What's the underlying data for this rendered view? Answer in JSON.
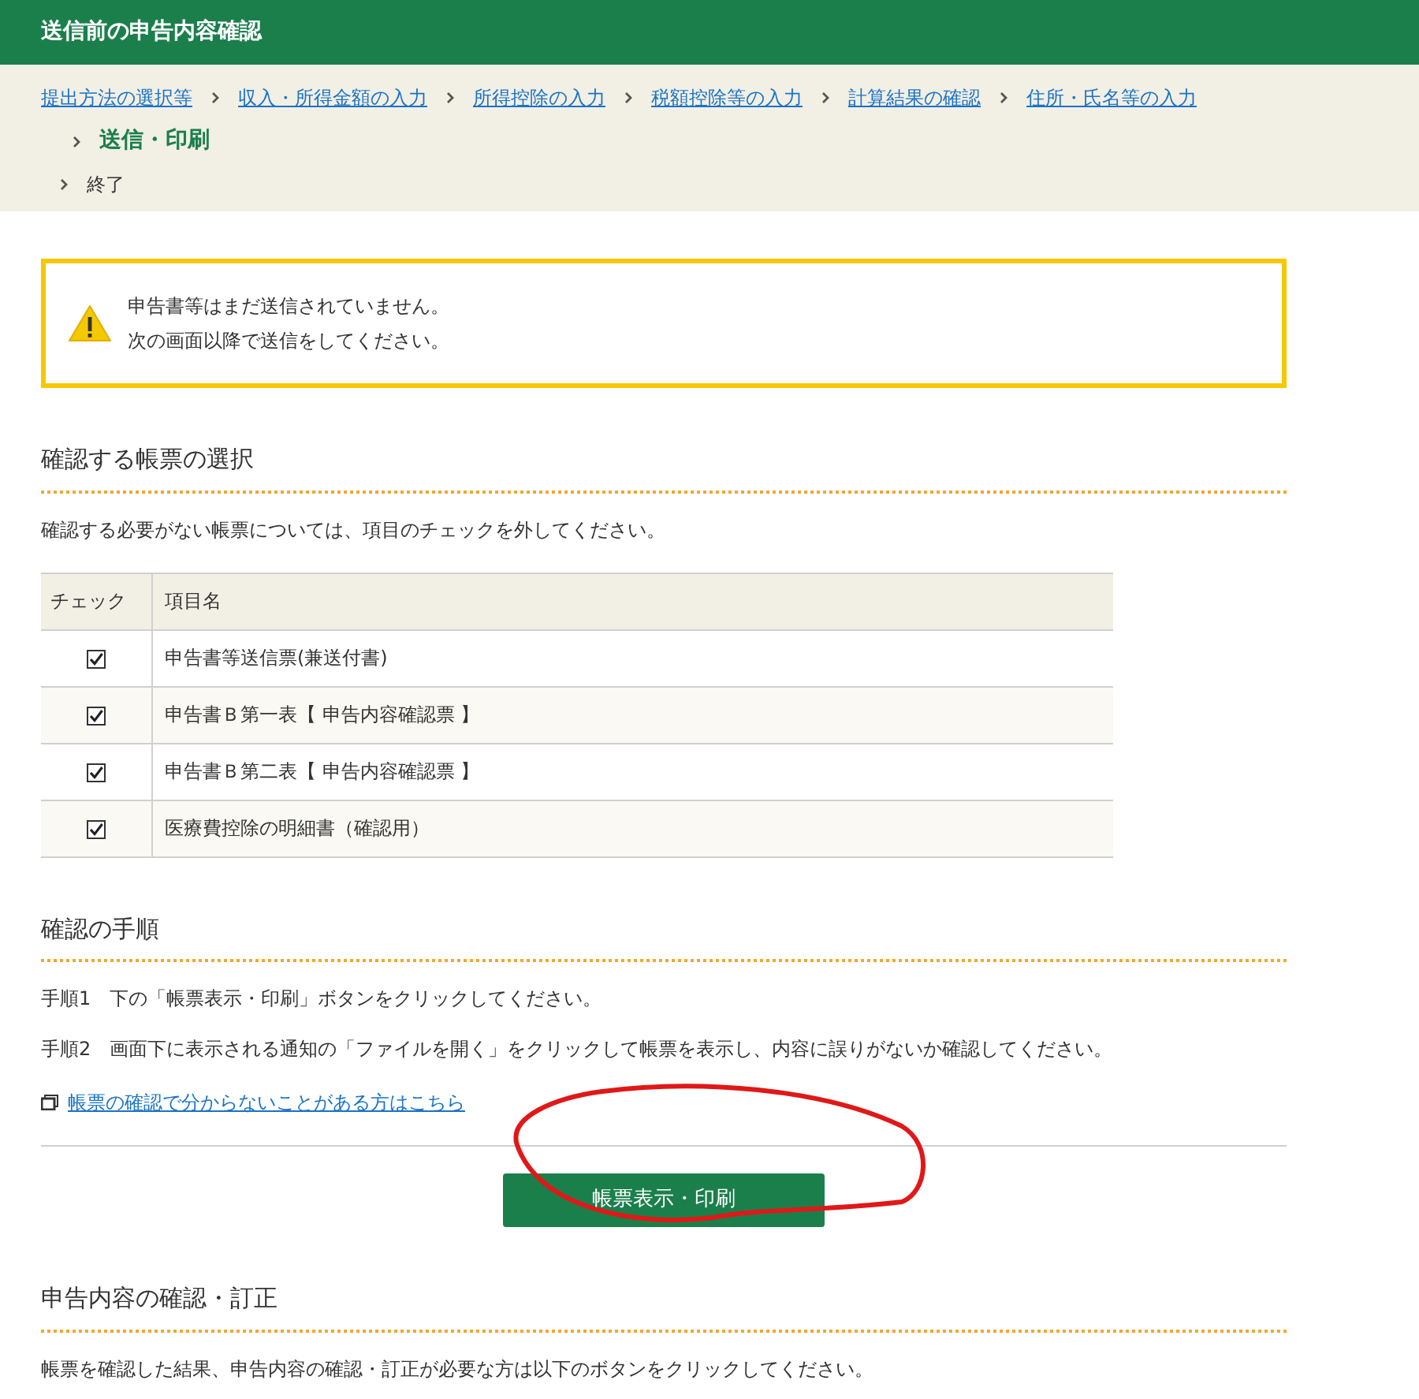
{
  "header": {
    "title": "送信前の申告内容確認"
  },
  "breadcrumb": [
    {
      "label": "提出方法の選択等",
      "kind": "link"
    },
    {
      "label": "収入・所得金額の入力",
      "kind": "link"
    },
    {
      "label": "所得控除の入力",
      "kind": "link"
    },
    {
      "label": "税額控除等の入力",
      "kind": "link"
    },
    {
      "label": "計算結果の確認",
      "kind": "link"
    },
    {
      "label": "住所・氏名等の入力",
      "kind": "link"
    },
    {
      "label": "送信・印刷",
      "kind": "current"
    },
    {
      "label": "終了",
      "kind": "plain"
    }
  ],
  "warning": {
    "lines": [
      "申告書等はまだ送信されていません。",
      "次の画面以降で送信をしてください。"
    ]
  },
  "form_selection": {
    "heading": "確認する帳票の選択",
    "description": "確認する必要がない帳票については、項目のチェックを外してください。",
    "columns": [
      "チェック",
      "項目名"
    ],
    "rows": [
      {
        "checked": true,
        "name": "申告書等送信票(兼送付書)"
      },
      {
        "checked": true,
        "name": "申告書Ｂ第一表【 申告内容確認票 】"
      },
      {
        "checked": true,
        "name": "申告書Ｂ第二表【 申告内容確認票 】"
      },
      {
        "checked": true,
        "name": "医療費控除の明細書（確認用）"
      }
    ]
  },
  "procedure": {
    "heading": "確認の手順",
    "steps": [
      "手順1　下の「帳票表示・印刷」ボタンをクリックしてください。",
      "手順2　画面下に表示される通知の「ファイルを開く」をクリックして帳票を表示し、内容に誤りがないか確認してください。"
    ],
    "help_link": "帳票の確認で分からないことがある方はこちら",
    "button": "帳票表示・印刷"
  },
  "correction": {
    "heading": "申告内容の確認・訂正",
    "description": "帳票を確認した結果、申告内容の確認・訂正が必要な方は以下のボタンをクリックしてください。"
  }
}
